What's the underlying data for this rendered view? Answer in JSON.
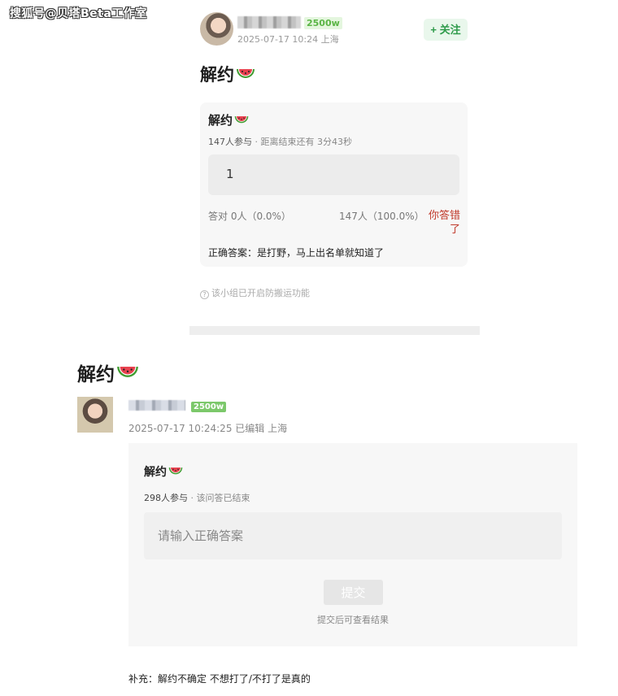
{
  "watermark": "搜狐号@贝塔Beta工作室",
  "post1": {
    "badge": "2500w",
    "meta": "2025-07-17 10:24  上海",
    "follow_label": "+ 关注",
    "title": "解约",
    "card": {
      "title": "解约",
      "participants": "147人参与",
      "status": " · 距离结束还有 3分43秒",
      "option": "1",
      "stat_correct": "答对  0人（0.0%）",
      "stat_count": "147人（100.0%）",
      "wrong_label": "你答错了",
      "answer": "正确答案：是打野，马上出名单就知道了"
    },
    "anti_copy": "该小组已开启防搬运功能"
  },
  "post2": {
    "title": "解约",
    "badge": "2500w",
    "meta": "2025-07-17 10:24:25 已编辑 上海",
    "card": {
      "title": "解约",
      "participants": "298人参与",
      "status": " · 该问答已结束",
      "input_placeholder": "请输入正确答案",
      "submit_label": "提交",
      "submit_hint": "提交后可查看结果"
    },
    "supplement": "补充：解约不确定 不想打了/不打了是真的"
  },
  "colors": {
    "follow_green": "#2f9b4b",
    "wrong_red": "#c0392b",
    "badge_green": "#7cc86b"
  },
  "icons": [
    "watermelon-icon",
    "question-circle-icon"
  ]
}
